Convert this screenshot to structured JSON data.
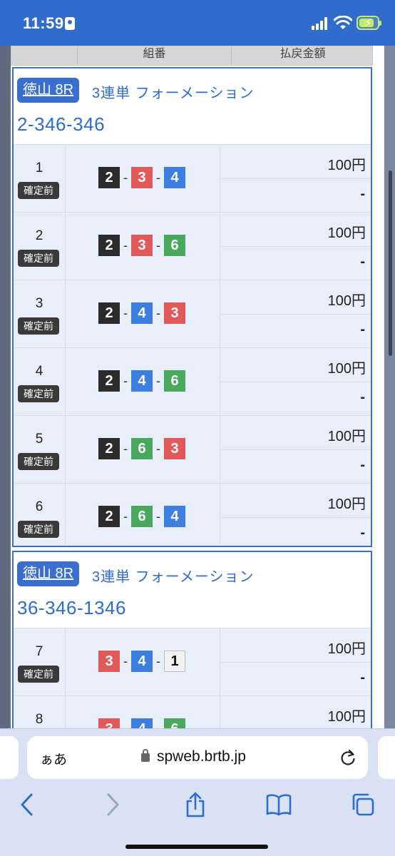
{
  "status_bar": {
    "time": "11:59"
  },
  "table": {
    "headers": [
      "",
      "組番",
      "払戻金額"
    ]
  },
  "blocks": [
    {
      "venue": "徳山 8R",
      "bet_type": "3連単 フォーメーション",
      "formation": "2-346-346",
      "rows": [
        {
          "no": "1",
          "status": "確定前",
          "boats": [
            "2",
            "3",
            "4"
          ],
          "amount": "100円",
          "payout": "-"
        },
        {
          "no": "2",
          "status": "確定前",
          "boats": [
            "2",
            "3",
            "6"
          ],
          "amount": "100円",
          "payout": "-"
        },
        {
          "no": "3",
          "status": "確定前",
          "boats": [
            "2",
            "4",
            "3"
          ],
          "amount": "100円",
          "payout": "-"
        },
        {
          "no": "4",
          "status": "確定前",
          "boats": [
            "2",
            "4",
            "6"
          ],
          "amount": "100円",
          "payout": "-"
        },
        {
          "no": "5",
          "status": "確定前",
          "boats": [
            "2",
            "6",
            "3"
          ],
          "amount": "100円",
          "payout": "-"
        },
        {
          "no": "6",
          "status": "確定前",
          "boats": [
            "2",
            "6",
            "4"
          ],
          "amount": "100円",
          "payout": "-"
        }
      ]
    },
    {
      "venue": "徳山 8R",
      "bet_type": "3連単 フォーメーション",
      "formation": "36-346-1346",
      "rows": [
        {
          "no": "7",
          "status": "確定前",
          "boats": [
            "3",
            "4",
            "1"
          ],
          "amount": "100円",
          "payout": "-"
        },
        {
          "no": "8",
          "status": "",
          "boats": [
            "3",
            "4",
            "6"
          ],
          "amount": "100円",
          "payout": ""
        }
      ]
    }
  ],
  "boat_colors": {
    "1": "#f2f2f2",
    "2": "#2b2b2b",
    "3": "#e05a5a",
    "4": "#3d7fe0",
    "6": "#48a85e"
  },
  "browser": {
    "text_size_label": "ぁあ",
    "url": "spweb.brtb.jp",
    "icons": [
      "back-icon",
      "forward-icon",
      "share-icon",
      "bookmarks-icon",
      "tabs-icon",
      "reload-icon",
      "lock-icon"
    ]
  }
}
